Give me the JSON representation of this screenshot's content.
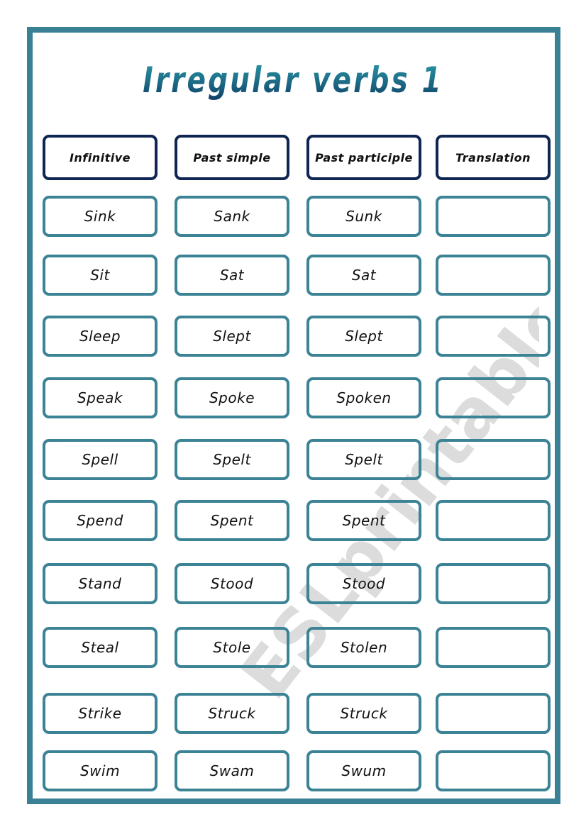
{
  "title": "Irregular verbs 1",
  "colors": {
    "frame": "#3a8196",
    "cell_border": "#3c8396",
    "header_border": "#0f2552",
    "title": "#1f6f86",
    "watermark": "#d9d9d9"
  },
  "watermark": "ESLprintables.com",
  "headers": [
    "Infinitive",
    "Past simple",
    "Past participle",
    "Translation"
  ],
  "rows": [
    {
      "infinitive": "Sink",
      "past_simple": "Sank",
      "past_participle": "Sunk",
      "translation": ""
    },
    {
      "infinitive": "Sit",
      "past_simple": "Sat",
      "past_participle": "Sat",
      "translation": ""
    },
    {
      "infinitive": "Sleep",
      "past_simple": "Slept",
      "past_participle": "Slept",
      "translation": ""
    },
    {
      "infinitive": "Speak",
      "past_simple": "Spoke",
      "past_participle": "Spoken",
      "translation": ""
    },
    {
      "infinitive": "Spell",
      "past_simple": "Spelt",
      "past_participle": "Spelt",
      "translation": ""
    },
    {
      "infinitive": "Spend",
      "past_simple": "Spent",
      "past_participle": "Spent",
      "translation": ""
    },
    {
      "infinitive": "Stand",
      "past_simple": "Stood",
      "past_participle": "Stood",
      "translation": ""
    },
    {
      "infinitive": "Steal",
      "past_simple": "Stole",
      "past_participle": "Stolen",
      "translation": ""
    },
    {
      "infinitive": "Strike",
      "past_simple": "Struck",
      "past_participle": "Struck",
      "translation": ""
    },
    {
      "infinitive": "Swim",
      "past_simple": "Swam",
      "past_participle": "Swum",
      "translation": ""
    }
  ]
}
